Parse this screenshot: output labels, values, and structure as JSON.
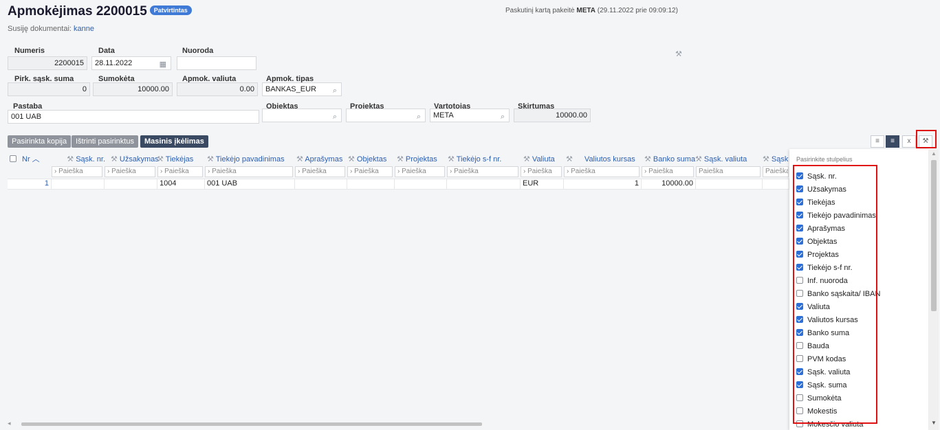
{
  "header": {
    "title": "Apmokėjimas 2200015",
    "status_badge": "Patvirtintas",
    "last_modified_prefix": "Paskutinį kartą pakeitė",
    "last_modified_user": "META",
    "last_modified_time": "(29.11.2022 prie 09:09:12)",
    "related_label": "Susiję dokumentai:",
    "related_link": "kanne"
  },
  "form": {
    "numeris": {
      "label": "Numeris",
      "value": "2200015"
    },
    "data": {
      "label": "Data",
      "value": "28.11.2022"
    },
    "nuoroda": {
      "label": "Nuoroda",
      "value": ""
    },
    "pirk_suma": {
      "label": "Pirk. sąsk. suma",
      "value": "0"
    },
    "sumoketa": {
      "label": "Sumokėta",
      "value": "10000.00"
    },
    "apmok_valiuta": {
      "label": "Apmok. valiuta",
      "value": "0.00"
    },
    "apmok_tipas": {
      "label": "Apmok. tipas",
      "value": "BANKAS_EUR"
    },
    "pastaba": {
      "label": "Pastaba",
      "value": "001 UAB"
    },
    "objektas": {
      "label": "Objektas",
      "value": ""
    },
    "projektas": {
      "label": "Projektas",
      "value": ""
    },
    "vartotojas": {
      "label": "Vartotojas",
      "value": "META"
    },
    "skirtumas": {
      "label": "Skirtumas",
      "value": "10000.00"
    }
  },
  "toolbar": {
    "copy_label": "Pasirinkta kopija",
    "delete_label": "Ištrinti pasirinktus",
    "mass_label": "Masinis įkėlimas"
  },
  "grid": {
    "search_placeholder": "Paieška",
    "headers": [
      "Nr",
      "Sąsk. nr.",
      "Užsakymas",
      "Tiekėjas",
      "Tiekėjo pavadinimas",
      "Aprašymas",
      "Objektas",
      "Projektas",
      "Tiekėjo s-f nr.",
      "Valiuta",
      "Valiutos kursas",
      "Banko suma",
      "Sąsk. valiuta",
      "Sąsk"
    ],
    "row": [
      "1",
      "",
      "",
      "1004",
      "001 UAB",
      "",
      "",
      "",
      "",
      "EUR",
      "1",
      "10000.00",
      "",
      ""
    ]
  },
  "column_picker": {
    "title": "Pasirinkite stulpelius",
    "items": [
      {
        "label": "Sąsk. nr.",
        "checked": true
      },
      {
        "label": "Užsakymas",
        "checked": true
      },
      {
        "label": "Tiekėjas",
        "checked": true
      },
      {
        "label": "Tiekėjo pavadinimas",
        "checked": true
      },
      {
        "label": "Aprašymas",
        "checked": true
      },
      {
        "label": "Objektas",
        "checked": true
      },
      {
        "label": "Projektas",
        "checked": true
      },
      {
        "label": "Tiekėjo s-f nr.",
        "checked": true
      },
      {
        "label": "Inf. nuoroda",
        "checked": false
      },
      {
        "label": "Banko sąskaita/ IBAN",
        "checked": false
      },
      {
        "label": "Valiuta",
        "checked": true
      },
      {
        "label": "Valiutos kursas",
        "checked": true
      },
      {
        "label": "Banko suma",
        "checked": true
      },
      {
        "label": "Bauda",
        "checked": false
      },
      {
        "label": "PVM kodas",
        "checked": false
      },
      {
        "label": "Sąsk. valiuta",
        "checked": true
      },
      {
        "label": "Sąsk. suma",
        "checked": true
      },
      {
        "label": "Sumokėta",
        "checked": false
      },
      {
        "label": "Mokestis",
        "checked": false
      },
      {
        "label": "Mokesčio valiuta",
        "checked": false
      }
    ]
  },
  "colors": {
    "accent": "#3f7ad6",
    "dark_button": "#3b4a63",
    "highlight": "#e01010"
  }
}
